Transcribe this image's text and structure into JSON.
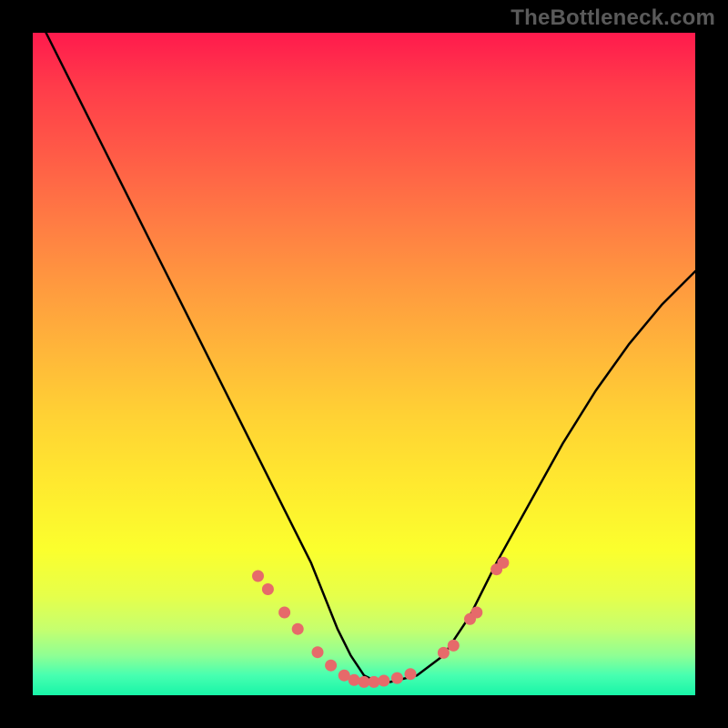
{
  "watermark": "TheBottleneck.com",
  "chart_data": {
    "type": "line",
    "title": "",
    "xlabel": "",
    "ylabel": "",
    "xlim": [
      0,
      100
    ],
    "ylim": [
      0,
      100
    ],
    "grid": false,
    "legend": false,
    "series": [
      {
        "name": "curve",
        "color": "#000000",
        "x": [
          2,
          6,
          10,
          14,
          18,
          22,
          26,
          30,
          34,
          38,
          42,
          46,
          48,
          50,
          52,
          54,
          58,
          62,
          66,
          70,
          75,
          80,
          85,
          90,
          95,
          100
        ],
        "values": [
          100,
          92,
          84,
          76,
          68,
          60,
          52,
          44,
          36,
          28,
          20,
          10,
          6,
          3,
          2,
          2,
          3,
          6,
          12,
          20,
          29,
          38,
          46,
          53,
          59,
          64
        ]
      }
    ],
    "markers": {
      "name": "dots",
      "color": "#e66a6a",
      "x": [
        34,
        35.5,
        38,
        40,
        43,
        45,
        47,
        48.5,
        50,
        51.5,
        53,
        55,
        57,
        62,
        63.5,
        66,
        67,
        70,
        71
      ],
      "values": [
        18,
        16,
        12.5,
        10,
        6.5,
        4.5,
        3,
        2.3,
        2,
        2,
        2.2,
        2.6,
        3.2,
        6.4,
        7.5,
        11.5,
        12.5,
        19,
        20
      ]
    }
  }
}
